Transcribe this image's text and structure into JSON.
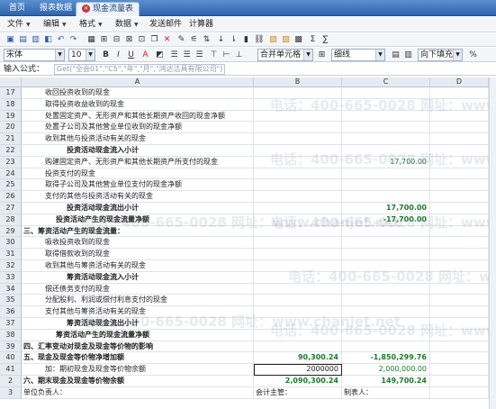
{
  "tabs": [
    {
      "label": "首页"
    },
    {
      "label": "报表数据"
    },
    {
      "label": "现金流量表"
    }
  ],
  "menus": [
    {
      "label": "文件"
    },
    {
      "label": "编辑"
    },
    {
      "label": "格式"
    },
    {
      "label": "数据"
    },
    {
      "label": "发送邮件"
    },
    {
      "label": "计算器"
    }
  ],
  "format": {
    "font": "宋体",
    "size": "10",
    "merge": "合并单元格",
    "border": "细线",
    "fill": "向下填充",
    "percent": "%"
  },
  "formula": {
    "label": "输入公式：",
    "value": "Get(\"全会01\",\"C5\",\"年\",\"月\",\"鸿达洁具有限公司\")"
  },
  "columns": [
    "A",
    "B",
    "C",
    "D"
  ],
  "rows": [
    {
      "n": "17",
      "a": "收回投资收到的现金",
      "b": "",
      "c": "",
      "indent": 2
    },
    {
      "n": "18",
      "a": "取得投资收益收到的现金",
      "b": "",
      "c": "",
      "indent": 2
    },
    {
      "n": "19",
      "a": "处置固定资产、无形资产和其他长期资产收回的现金净额",
      "b": "",
      "c": "",
      "indent": 2
    },
    {
      "n": "20",
      "a": "处置子公司及其他营业单位收到的现金净额",
      "b": "",
      "c": "",
      "indent": 2
    },
    {
      "n": "21",
      "a": "收到其他与投资活动有关的现金",
      "b": "",
      "c": "",
      "indent": 2
    },
    {
      "n": "22",
      "a": "投资活动现金流入小计",
      "b": "",
      "c": "",
      "indent": 4,
      "bold": true
    },
    {
      "n": "23",
      "a": "购建固定资产、无形资产和其他长期资产所支付的现金",
      "b": "",
      "c": "17,700.00",
      "indent": 2
    },
    {
      "n": "24",
      "a": "投资支付的现金",
      "b": "",
      "c": "",
      "indent": 2
    },
    {
      "n": "25",
      "a": "取得子公司及其他营业单位支付的现金净额",
      "b": "",
      "c": "",
      "indent": 2
    },
    {
      "n": "26",
      "a": "支付的其他与投资活动有关的现金",
      "b": "",
      "c": "",
      "indent": 2
    },
    {
      "n": "27",
      "a": "投资活动现金流出小计",
      "b": "",
      "c": "17,700.00",
      "indent": 4,
      "bold": true
    },
    {
      "n": "28",
      "a": "投资活动产生的现金流量净额",
      "b": "",
      "c": "-17,700.00",
      "indent": 3,
      "bold": true
    },
    {
      "n": "29",
      "a": "三、筹资活动产生的现金流量：",
      "b": "",
      "c": "",
      "indent": 0,
      "bold": true
    },
    {
      "n": "30",
      "a": "吸收投资收到的现金",
      "b": "",
      "c": "",
      "indent": 2
    },
    {
      "n": "31",
      "a": "取得借款收到的现金",
      "b": "",
      "c": "",
      "indent": 2
    },
    {
      "n": "32",
      "a": "收到其他与筹资活动有关的现金",
      "b": "",
      "c": "",
      "indent": 2
    },
    {
      "n": "33",
      "a": "筹资活动现金流入小计",
      "b": "",
      "c": "",
      "indent": 4,
      "bold": true
    },
    {
      "n": "34",
      "a": "偿还债务支付的现金",
      "b": "",
      "c": "",
      "indent": 2
    },
    {
      "n": "35",
      "a": "分配股利、利润或偿付利息支付的现金",
      "b": "",
      "c": "",
      "indent": 2
    },
    {
      "n": "36",
      "a": "支付其他与筹资活动有关的现金",
      "b": "",
      "c": "",
      "indent": 2
    },
    {
      "n": "37",
      "a": "筹资活动现金流出小计",
      "b": "",
      "c": "",
      "indent": 4,
      "bold": true
    },
    {
      "n": "38",
      "a": "筹资活动产生的现金流量净额",
      "b": "",
      "c": "",
      "indent": 3,
      "bold": true
    },
    {
      "n": "39",
      "a": "四、汇率变动对现金及现金等价物的影响",
      "b": "",
      "c": "",
      "indent": 0,
      "bold": true
    },
    {
      "n": "40",
      "a": "五、现金及现金等价物净增加额",
      "b": "90,300.24",
      "c": "-1,850,299.76",
      "indent": 0,
      "bold": true
    },
    {
      "n": "41",
      "a": "加：期初现金及现金等价物余额",
      "b": "2000000",
      "c": "2,000,000.00",
      "indent": 2,
      "selected": true
    },
    {
      "n": "2",
      "a": "六、期末现金及现金等价物余额",
      "b": "2,090,300.24",
      "c": "149,700.24",
      "indent": 0,
      "bold": true
    },
    {
      "n": "3",
      "a": "单位负责人：",
      "b": "会计主管：",
      "c": "制表人：",
      "indent": 0,
      "footer": true
    }
  ],
  "watermark": "电话：400-665-0028  网址：www.chanjet.net",
  "colors": {
    "accent": "#2f64ad",
    "positive": "#1c7a2a"
  }
}
